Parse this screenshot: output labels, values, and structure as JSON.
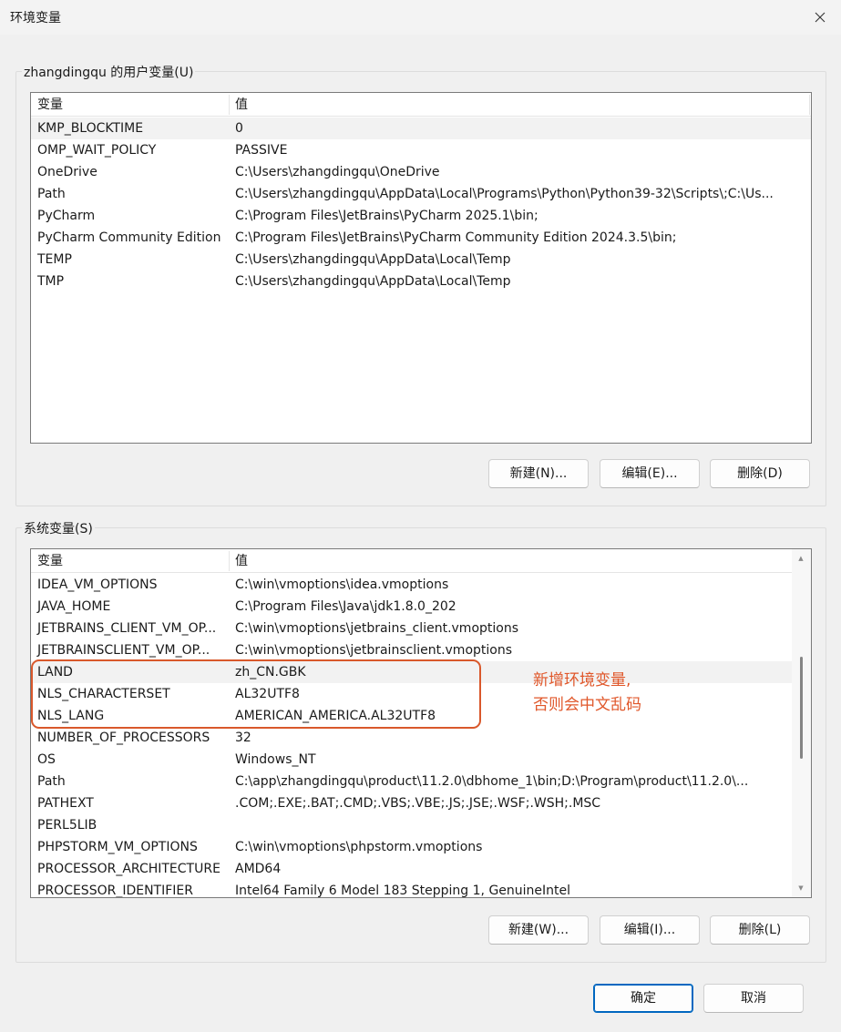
{
  "window": {
    "title": "环境变量"
  },
  "user_vars": {
    "group_label": "zhangdingqu 的用户变量(U)",
    "col_variable": "变量",
    "col_value": "值",
    "rows": [
      {
        "name": "KMP_BLOCKTIME",
        "value": "0"
      },
      {
        "name": "OMP_WAIT_POLICY",
        "value": "PASSIVE"
      },
      {
        "name": "OneDrive",
        "value": "C:\\Users\\zhangdingqu\\OneDrive"
      },
      {
        "name": "Path",
        "value": "C:\\Users\\zhangdingqu\\AppData\\Local\\Programs\\Python\\Python39-32\\Scripts\\;C:\\Us..."
      },
      {
        "name": "PyCharm",
        "value": "C:\\Program Files\\JetBrains\\PyCharm 2025.1\\bin;"
      },
      {
        "name": "PyCharm Community Edition",
        "value": "C:\\Program Files\\JetBrains\\PyCharm Community Edition 2024.3.5\\bin;"
      },
      {
        "name": "TEMP",
        "value": "C:\\Users\\zhangdingqu\\AppData\\Local\\Temp"
      },
      {
        "name": "TMP",
        "value": "C:\\Users\\zhangdingqu\\AppData\\Local\\Temp"
      }
    ],
    "buttons": {
      "new": "新建(N)...",
      "edit": "编辑(E)...",
      "delete": "删除(D)"
    }
  },
  "system_vars": {
    "group_label": "系统变量(S)",
    "col_variable": "变量",
    "col_value": "值",
    "rows": [
      {
        "name": "IDEA_VM_OPTIONS",
        "value": "C:\\win\\vmoptions\\idea.vmoptions"
      },
      {
        "name": "JAVA_HOME",
        "value": "C:\\Program Files\\Java\\jdk1.8.0_202"
      },
      {
        "name": "JETBRAINS_CLIENT_VM_OP...",
        "value": "C:\\win\\vmoptions\\jetbrains_client.vmoptions"
      },
      {
        "name": "JETBRAINSCLIENT_VM_OP...",
        "value": "C:\\win\\vmoptions\\jetbrainsclient.vmoptions"
      },
      {
        "name": "LAND",
        "value": "zh_CN.GBK"
      },
      {
        "name": "NLS_CHARACTERSET",
        "value": "AL32UTF8"
      },
      {
        "name": "NLS_LANG",
        "value": "AMERICAN_AMERICA.AL32UTF8"
      },
      {
        "name": "NUMBER_OF_PROCESSORS",
        "value": "32"
      },
      {
        "name": "OS",
        "value": "Windows_NT"
      },
      {
        "name": "Path",
        "value": "C:\\app\\zhangdingqu\\product\\11.2.0\\dbhome_1\\bin;D:\\Program\\product\\11.2.0\\..."
      },
      {
        "name": "PATHEXT",
        "value": ".COM;.EXE;.BAT;.CMD;.VBS;.VBE;.JS;.JSE;.WSF;.WSH;.MSC"
      },
      {
        "name": "PERL5LIB",
        "value": ""
      },
      {
        "name": "PHPSTORM_VM_OPTIONS",
        "value": "C:\\win\\vmoptions\\phpstorm.vmoptions"
      },
      {
        "name": "PROCESSOR_ARCHITECTURE",
        "value": "AMD64"
      },
      {
        "name": "PROCESSOR_IDENTIFIER",
        "value": "Intel64 Family 6 Model 183 Stepping 1, GenuineIntel"
      }
    ],
    "buttons": {
      "new": "新建(W)...",
      "edit": "编辑(I)...",
      "delete": "删除(L)"
    }
  },
  "annotation": {
    "line1": "新增环境变量,",
    "line2": "否则会中文乱码",
    "color": "#e0572a"
  },
  "dialog_buttons": {
    "ok": "确定",
    "cancel": "取消"
  }
}
